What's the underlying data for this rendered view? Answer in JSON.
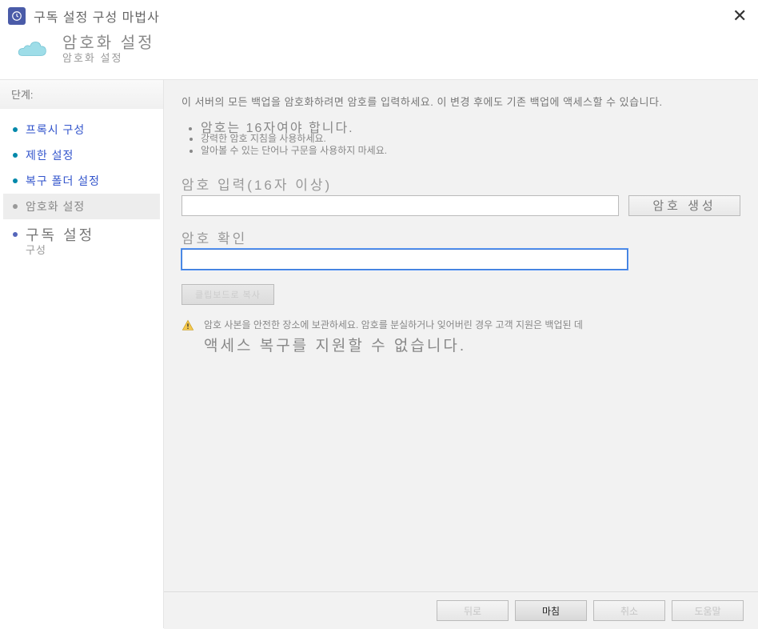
{
  "window": {
    "title": "구독 설정 구성 마법사"
  },
  "header": {
    "title": "암호화 설정",
    "subtitle": "암호화 설정"
  },
  "sidebar": {
    "stepsLabel": "단계:",
    "items": [
      {
        "label": "프록시 구성",
        "state": "done"
      },
      {
        "label": "제한 설정",
        "state": "done"
      },
      {
        "label": "복구 폴더 설정",
        "state": "done"
      },
      {
        "label": "암호화 설정",
        "state": "current"
      },
      {
        "label": "구독 설정",
        "sub": "구성",
        "state": "future"
      }
    ]
  },
  "content": {
    "intro": "이 서버의 모든 백업을 암호화하려면 암호를 입력하세요. 이 변경 후에도 기존 백업에 액세스할 수 있습니다.",
    "rules": [
      "암호는 16자여야 합니다.",
      "강력한 암호 지침을 사용하세요.",
      "알아볼 수 있는 단어나 구문을 사용하지 마세요."
    ],
    "password": {
      "label": "암호 입력(16자 이상)",
      "value": "",
      "generateBtn": "암호 생성"
    },
    "confirm": {
      "label": "암호 확인",
      "value": ""
    },
    "clipboardBtn": "클립보드로 복사",
    "warning": {
      "line1": "암호 사본을 안전한 장소에 보관하세요. 암호를 분실하거나 잊어버린 경우 고객 지원은 백업된 데",
      "line2": "액세스 복구를 지원할 수 없습니다."
    }
  },
  "footer": {
    "back": "뒤로",
    "finish": "마침",
    "cancel": "취소",
    "help": "도움말"
  }
}
